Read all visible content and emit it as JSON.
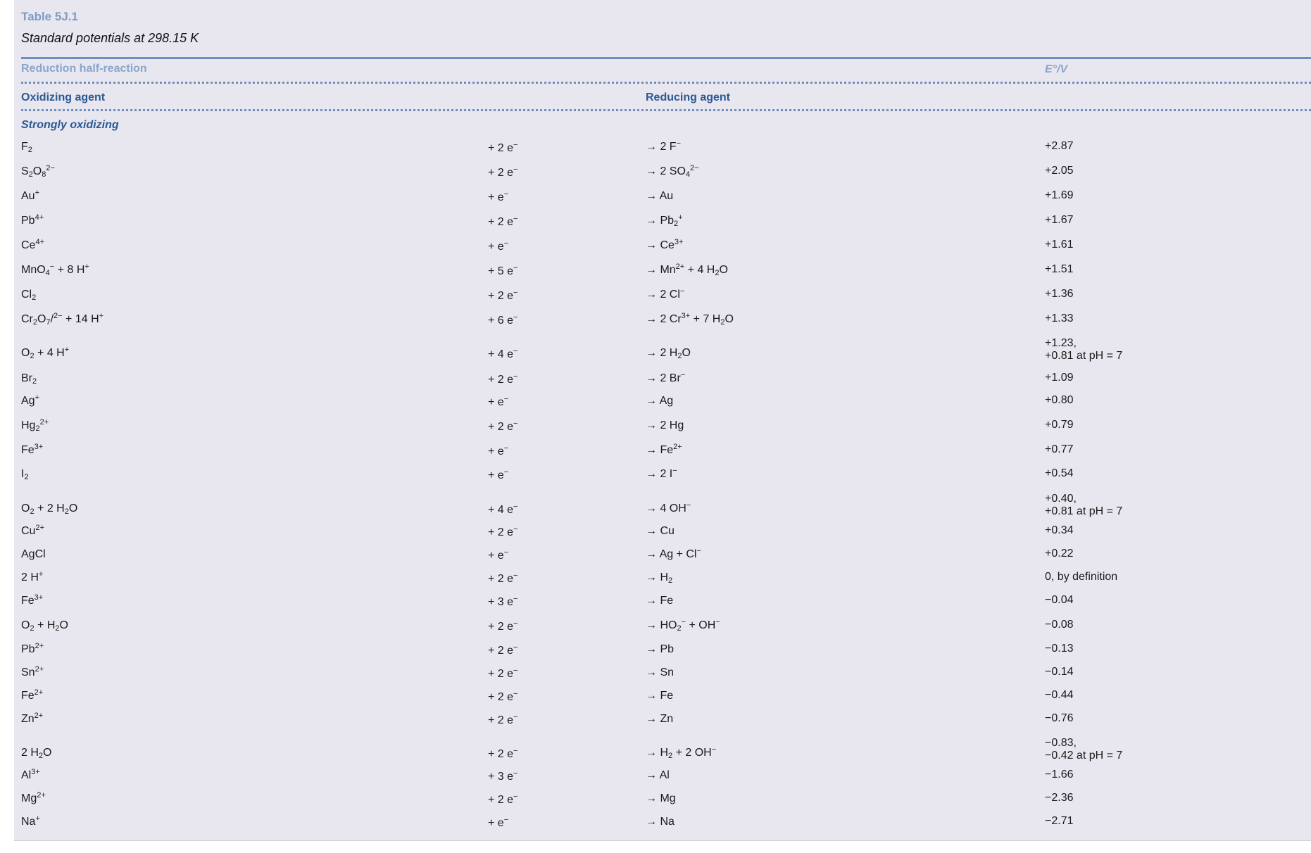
{
  "table": {
    "number": "Table 5J.1",
    "title": "Standard potentials at 298.15 K",
    "header_group": "Reduction half-reaction",
    "header_value": "E°/V",
    "col_oxidizing": "Oxidizing agent",
    "col_reducing": "Reducing agent",
    "section_label": "Strongly oxidizing"
  },
  "rows": [
    {
      "ox": "F<sub>2</sub>",
      "el": "+ 2 e<sup>−</sup>",
      "red": "→ 2 F<sup>−</sup>",
      "e": "+2.87"
    },
    {
      "ox": "S<sub>2</sub>O<sub>8</sub><sup>2−</sup>",
      "el": "+ 2 e<sup>−</sup>",
      "red": "→ 2 SO<sub>4</sub><sup>2−</sup>",
      "e": "+2.05"
    },
    {
      "ox": "Au<sup>+</sup>",
      "el": "+ e<sup>−</sup>",
      "red": "→ Au",
      "e": "+1.69"
    },
    {
      "ox": "Pb<sup>4+</sup>",
      "el": "+ 2 e<sup>−</sup>",
      "red": "→ Pb<sub>2</sub><sup>+</sup>",
      "e": "+1.67"
    },
    {
      "ox": "Ce<sup>4+</sup>",
      "el": "+ e<sup>−</sup>",
      "red": "→ Ce<sup>3+</sup>",
      "e": "+1.61"
    },
    {
      "ox": "MnO<sub>4</sub><sup>−</sup> + 8 H<sup>+</sup>",
      "el": "+ 5 e<sup>−</sup>",
      "red": "→ Mn<sup>2+</sup> + 4 H<sub>2</sub>O",
      "e": "+1.51"
    },
    {
      "ox": "Cl<sub>2</sub>",
      "el": "+ 2 e<sup>−</sup>",
      "red": "→ 2 Cl<sup>−</sup>",
      "e": "+1.36"
    },
    {
      "ox": "Cr<sub>2</sub>O<sub>7</sub>/<sup>2−</sup> + 14 H<sup>+</sup>",
      "el": "+ 6 e<sup>−</sup>",
      "red": "→ 2 Cr<sup>3+</sup> + 7 H<sub>2</sub>O",
      "e": "+1.33"
    },
    {
      "ox": "O<sub>2</sub> + 4 H<sup>+</sup>",
      "el": "+ 4 e<sup>−</sup>",
      "red": "→ 2 H<sub>2</sub>O",
      "e": "+1.23,",
      "e2": "+0.81 at pH = 7"
    },
    {
      "ox": "Br<sub>2</sub>",
      "el": "+ 2 e<sup>−</sup>",
      "red": "→ 2 Br<sup>−</sup>",
      "e": "+1.09"
    },
    {
      "ox": "Ag<sup>+</sup>",
      "el": "+ e<sup>−</sup>",
      "red": "→ Ag",
      "e": "+0.80"
    },
    {
      "ox": "Hg<sub>2</sub><sup>2+</sup>",
      "el": "+ 2 e<sup>−</sup>",
      "red": "→ 2 Hg",
      "e": "+0.79"
    },
    {
      "ox": "Fe<sup>3+</sup>",
      "el": "+ e<sup>−</sup>",
      "red": "→ Fe<sup>2+</sup>",
      "e": "+0.77"
    },
    {
      "ox": "I<sub>2</sub>",
      "el": "+ e<sup>−</sup>",
      "red": "→ 2 I<sup>−</sup>",
      "e": "+0.54"
    },
    {
      "ox": "O<sub>2</sub> + 2 H<sub>2</sub>O",
      "el": "+ 4 e<sup>−</sup>",
      "red": "→ 4 OH<sup>−</sup>",
      "e": "+0.40,",
      "e2": "+0.81 at pH = 7"
    },
    {
      "ox": "Cu<sup>2+</sup>",
      "el": "+ 2 e<sup>−</sup>",
      "red": "→ Cu",
      "e": "+0.34"
    },
    {
      "ox": "AgCl",
      "el": "+ e<sup>−</sup>",
      "red": "→ Ag + Cl<sup>−</sup>",
      "e": "+0.22"
    },
    {
      "ox": "2 H<sup>+</sup>",
      "el": "+ 2 e<sup>−</sup>",
      "red": "→ H<sub>2</sub>",
      "e": "0, by definition"
    },
    {
      "ox": "Fe<sup>3+</sup>",
      "el": "+ 3 e<sup>−</sup>",
      "red": "→ Fe",
      "e": "−0.04"
    },
    {
      "ox": "O<sub>2</sub> + H<sub>2</sub>O",
      "el": "+ 2 e<sup>−</sup>",
      "red": "→ HO<sub>2</sub><sup>−</sup> + OH<sup>−</sup>",
      "e": "−0.08"
    },
    {
      "ox": "Pb<sup>2+</sup>",
      "el": "+ 2 e<sup>−</sup>",
      "red": "→ Pb",
      "e": "−0.13"
    },
    {
      "ox": "Sn<sup>2+</sup>",
      "el": "+ 2 e<sup>−</sup>",
      "red": "→ Sn",
      "e": "−0.14"
    },
    {
      "ox": "Fe<sup>2+</sup>",
      "el": "+ 2 e<sup>−</sup>",
      "red": "→ Fe",
      "e": "−0.44"
    },
    {
      "ox": "Zn<sup>2+</sup>",
      "el": "+ 2 e<sup>−</sup>",
      "red": "→ Zn",
      "e": "−0.76"
    },
    {
      "ox": "2 H<sub>2</sub>O",
      "el": "+ 2 e<sup>−</sup>",
      "red": "→ H<sub>2</sub> + 2 OH<sup>−</sup>",
      "e": "−0.83,",
      "e2": "−0.42 at pH = 7"
    },
    {
      "ox": "Al<sup>3+</sup>",
      "el": "+ 3 e<sup>−</sup>",
      "red": "→ Al",
      "e": "−1.66"
    },
    {
      "ox": "Mg<sup>2+</sup>",
      "el": "+ 2 e<sup>−</sup>",
      "red": "→ Mg",
      "e": "−2.36"
    },
    {
      "ox": "Na<sup>+</sup>",
      "el": "+ e<sup>−</sup>",
      "red": "→ Na",
      "e": "−2.71"
    }
  ]
}
